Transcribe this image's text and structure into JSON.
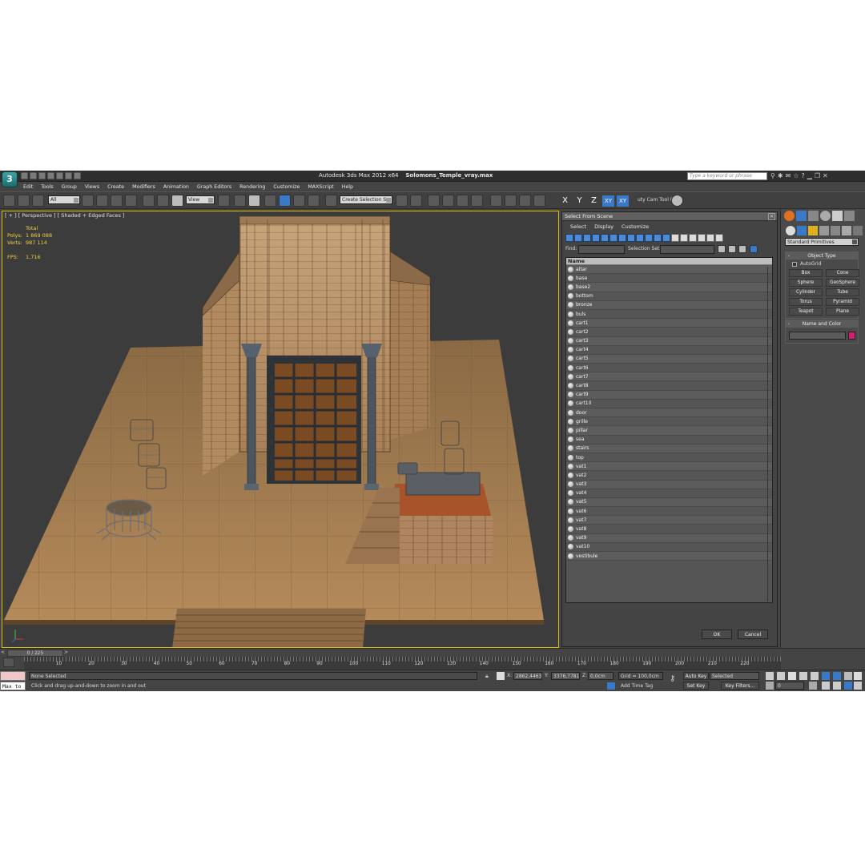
{
  "app": {
    "title": "Autodesk 3ds Max  2012 x64",
    "file": "Solomons_Temple_vray.max",
    "search_placeholder": "Type a keyword or phrase",
    "logo": "3"
  },
  "menu": [
    "Edit",
    "Tools",
    "Group",
    "Views",
    "Create",
    "Modifiers",
    "Animation",
    "Graph Editors",
    "Rendering",
    "Customize",
    "MAXScript",
    "Help"
  ],
  "toolbar": {
    "filter": "All",
    "ref_coord": "View",
    "selection_set": "Create Selection Se",
    "axis_x": "X",
    "axis_y": "Y",
    "axis_z": "Z",
    "axis_xy": "XY",
    "axis_xy2": "XY",
    "cam_tool": "uty Cam Tool ("
  },
  "viewport": {
    "label": "[ + ] [ Perspective ] [ Shaded + Edged Faces ]",
    "stats_header": "Total",
    "polys_label": "Polys:",
    "polys_value": "1 869 088",
    "verts_label": "Verts:",
    "verts_value": "987 114",
    "fps_label": "FPS:",
    "fps_value": "1,716"
  },
  "dialog": {
    "title": "Select From Scene",
    "menu": [
      "Select",
      "Display",
      "Customize"
    ],
    "find_label": "Find:",
    "selection_set_label": "Selection Set:",
    "column_name": "Name",
    "objects": [
      "altar",
      "base",
      "base2",
      "bottom",
      "bronze",
      "buls",
      "cart1",
      "cart2",
      "cart3",
      "cart4",
      "cart5",
      "cart6",
      "cart7",
      "cart8",
      "cart9",
      "cart10",
      "door",
      "grille",
      "pillar",
      "sea",
      "stairs",
      "top",
      "vat1",
      "vat2",
      "vat3",
      "vat4",
      "vat5",
      "vat6",
      "vat7",
      "vat8",
      "vat9",
      "vat10",
      "vestibule"
    ],
    "ok": "OK",
    "cancel": "Cancel"
  },
  "command_panel": {
    "category": "Standard Primitives",
    "object_type_title": "Object Type",
    "autogrid": "AutoGrid",
    "primitives": [
      "Box",
      "Cone",
      "Sphere",
      "GeoSphere",
      "Cylinder",
      "Tube",
      "Torus",
      "Pyramid",
      "Teapot",
      "Plane"
    ],
    "name_color_title": "Name and Color",
    "color": "#d81c74"
  },
  "timeline": {
    "frame": "0 / 225",
    "ticks": [
      "10",
      "20",
      "30",
      "40",
      "50",
      "60",
      "70",
      "80",
      "90",
      "100",
      "110",
      "120",
      "130",
      "140",
      "150",
      "160",
      "170",
      "180",
      "190",
      "200",
      "210",
      "220"
    ],
    "frame_value": 0,
    "frame_total": 225
  },
  "status": {
    "listener": "Max to",
    "selection": "None Selected",
    "prompt": "Click and drag up-and-down to zoom in and out",
    "x_label": "X:",
    "x_value": "2862,4463",
    "y_label": "Y:",
    "y_value": "3376,7781",
    "z_label": "Z:",
    "z_value": "0,0cm",
    "grid": "Grid = 100,0cm",
    "auto_key": "Auto Key",
    "set_key": "Set Key",
    "key_mode": "Selected",
    "key_filters": "Key Filters...",
    "add_time_tag": "Add Time Tag",
    "frame_field": "0"
  }
}
